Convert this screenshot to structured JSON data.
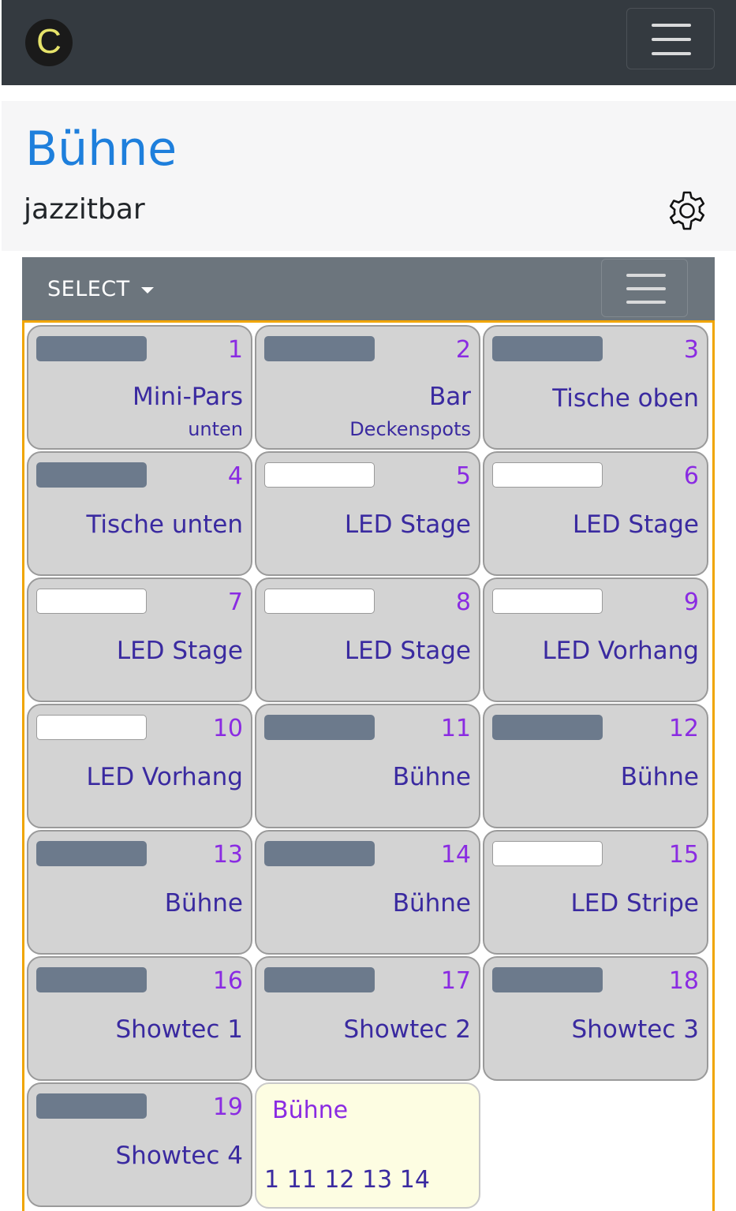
{
  "app": {
    "logo_letter": "C"
  },
  "header": {
    "title": "Bühne",
    "subtitle": "jazzitbar"
  },
  "toolbar": {
    "select_label": "SELECT"
  },
  "colors": {
    "accent": "#f0a500",
    "title_blue": "#1e7fdc",
    "number_purple": "#8a2be2",
    "label_indigo": "#3a2aa0",
    "bar_off": "#6c7a8c",
    "bar_on": "#ffffff"
  },
  "devices": [
    {
      "number": "1",
      "name": "Mini-Pars",
      "sub": "unten",
      "on": false
    },
    {
      "number": "2",
      "name": "Bar",
      "sub": "Deckenspots",
      "on": false
    },
    {
      "number": "3",
      "name": "Tische oben",
      "sub": "",
      "on": false
    },
    {
      "number": "4",
      "name": "Tische unten",
      "sub": "",
      "on": false
    },
    {
      "number": "5",
      "name": "LED Stage",
      "sub": "",
      "on": true
    },
    {
      "number": "6",
      "name": "LED Stage",
      "sub": "",
      "on": true
    },
    {
      "number": "7",
      "name": "LED Stage",
      "sub": "",
      "on": true
    },
    {
      "number": "8",
      "name": "LED Stage",
      "sub": "",
      "on": true
    },
    {
      "number": "9",
      "name": "LED Vorhang",
      "sub": "",
      "on": true
    },
    {
      "number": "10",
      "name": "LED Vorhang",
      "sub": "",
      "on": true
    },
    {
      "number": "11",
      "name": "Bühne",
      "sub": "",
      "on": false
    },
    {
      "number": "12",
      "name": "Bühne",
      "sub": "",
      "on": false
    },
    {
      "number": "13",
      "name": "Bühne",
      "sub": "",
      "on": false
    },
    {
      "number": "14",
      "name": "Bühne",
      "sub": "",
      "on": false
    },
    {
      "number": "15",
      "name": "LED Stripe",
      "sub": "",
      "on": true
    },
    {
      "number": "16",
      "name": "Showtec 1",
      "sub": "",
      "on": false
    },
    {
      "number": "17",
      "name": "Showtec 2",
      "sub": "",
      "on": false
    },
    {
      "number": "18",
      "name": "Showtec 3",
      "sub": "",
      "on": false
    },
    {
      "number": "19",
      "name": "Showtec 4",
      "sub": "",
      "on": false
    }
  ],
  "group": {
    "name": "Bühne",
    "members": "1 11 12 13 14"
  }
}
